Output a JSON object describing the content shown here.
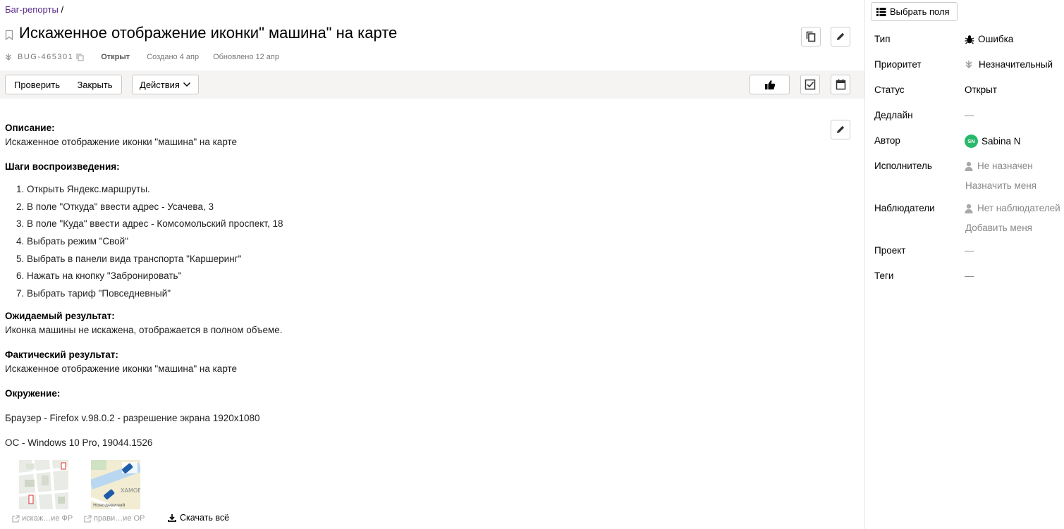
{
  "breadcrumb": {
    "parent": "Баг-репорты",
    "separator": "/"
  },
  "issue": {
    "title": "Искаженное отображение иконки\" машина\" на карте",
    "key": "BUG-465301",
    "status": "Открыт",
    "created": "Создано 4 апр",
    "updated": "Обновлено 12 апр"
  },
  "toolbar": {
    "check_label": "Проверить",
    "close_label": "Закрыть",
    "actions_label": "Действия"
  },
  "description": {
    "desc_heading": "Описание:",
    "desc_text": "Искаженное отображение иконки \"машина\" на карте",
    "steps_heading": "Шаги воспроизведения:",
    "steps": [
      "1. Открыть Яндекс.маршруты.",
      "2. В поле \"Откуда\" ввести адрес - Усачева, 3",
      "3. В поле \"Куда\" ввести адрес - Комсомольский проспект, 18",
      "4. Выбрать режим \"Свой\"",
      "5. Выбрать в панели вида транспорта \"Каршеринг\"",
      "6. Нажать на кнопку \"Забронировать\"",
      "7. Выбрать тариф \"Повседневный\""
    ],
    "expected_heading": "Ожидаемый результат:",
    "expected_text": "Иконка машины не искажена, отображается в полном объеме.",
    "actual_heading": "Фактический результат:",
    "actual_text": "Искаженное отображение иконки \"машина\" на карте",
    "env_heading": "Окружение:",
    "env_browser": "Браузер - Firefox v.98.0.2 - разрешение экрана 1920x1080",
    "env_os": "ОС - Windows 10 Pro, 19044.1526"
  },
  "attachments": {
    "files": [
      {
        "caption": "искаж…ие ФР"
      },
      {
        "caption": "прави…ие ОР",
        "map_label_1": "ХАМОВ",
        "map_label_2": "Новодевичий"
      }
    ],
    "download_all": "Скачать всё"
  },
  "sidebar": {
    "select_fields_label": "Выбрать поля",
    "fields": {
      "type_label": "Тип",
      "type_value": "Ошибка",
      "priority_label": "Приоритет",
      "priority_value": "Незначительный",
      "status_label": "Статус",
      "status_value": "Открыт",
      "deadline_label": "Дедлайн",
      "deadline_value": "—",
      "author_label": "Автор",
      "author_initials": "SN",
      "author_name": "Sabina N",
      "assignee_label": "Исполнитель",
      "assignee_value": "Не назначен",
      "assign_me": "Назначить меня",
      "watchers_label": "Наблюдатели",
      "watchers_value": "Нет наблюдателей",
      "add_me": "Добавить меня",
      "project_label": "Проект",
      "project_value": "—",
      "tags_label": "Теги",
      "tags_value": "—"
    }
  },
  "colors": {
    "avatar": "#29b86a",
    "breadcrumb_link": "#5a2b8a",
    "toolbar_bg": "#f5f4f2"
  }
}
